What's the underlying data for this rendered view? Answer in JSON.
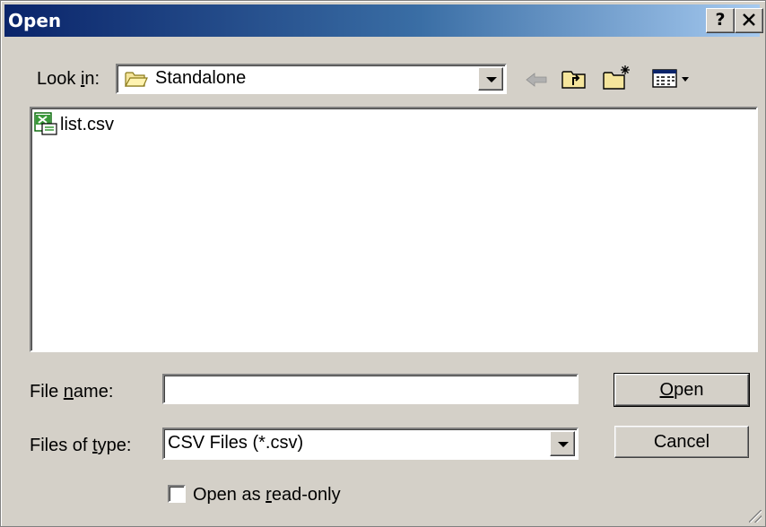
{
  "window": {
    "title": "Open",
    "help_label": "?",
    "close_label": "✕"
  },
  "lookin": {
    "label_pre": "Look ",
    "label_key": "i",
    "label_post": "n:",
    "value": "Standalone"
  },
  "files": [
    {
      "name": "list.csv",
      "icon": "excel-csv-icon"
    }
  ],
  "filename": {
    "label_pre": "File ",
    "label_key": "n",
    "label_post": "ame:",
    "value": ""
  },
  "filetype": {
    "label_pre": "Files of ",
    "label_key": "t",
    "label_post": "ype:",
    "value": "CSV Files (*.csv)"
  },
  "buttons": {
    "open_key": "O",
    "open_rest": "pen",
    "cancel": "Cancel"
  },
  "readonly": {
    "label_pre": "Open as ",
    "label_key": "r",
    "label_post": "ead-only",
    "checked": false
  },
  "colors": {
    "title_start": "#0a246a",
    "title_end": "#a6caf0",
    "face": "#d4d0c8"
  }
}
